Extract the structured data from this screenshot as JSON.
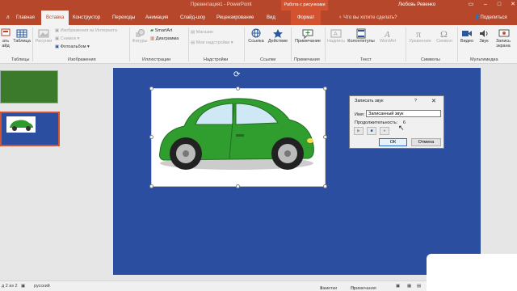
{
  "titlebar": {
    "title": "Презентация1 - PowerPoint",
    "context_title": "Работа с рисунками",
    "user": "Любовь Ревенко",
    "accent": "#b7472a"
  },
  "tabs": [
    "Главная",
    "Вставка",
    "Конструктор",
    "Переходы",
    "Анимация",
    "Слайд-шоу",
    "Рецензирование",
    "Вид",
    "Формат"
  ],
  "active_tab": "Вставка",
  "search_placeholder": "Что вы хотите сделать?",
  "share": "Поделиться",
  "ribbon": {
    "new_slide_label": "ать",
    "new_slide_label2": "айд",
    "table_label": "Таблица",
    "tables_group": "Таблицы",
    "pictures_label": "Рисунки",
    "online_pictures": "Изображения из Интернета",
    "screenshot": "Снимок",
    "photo_album": "Фотоальбом",
    "images_group": "Изображения",
    "shapes_label": "Фигуры",
    "smartart": "SmartArt",
    "chart": "Диаграмма",
    "illustrations_group": "Иллюстрации",
    "store": "Магазин",
    "my_addins": "Мои надстройки",
    "addins_group": "Надстройки",
    "link": "Ссылка",
    "action": "Действие",
    "links_group": "Ссылки",
    "comment": "Примечание",
    "comments_group": "Примечания",
    "textbox": "Надпись",
    "header_footer": "Колонтитулы",
    "wordart": "WordArt",
    "text_group": "Текст",
    "equation": "Уравнение",
    "symbol": "Символ",
    "symbols_group": "Символы",
    "video": "Видео",
    "audio": "Звук",
    "screen_recording": "Запись экрана",
    "media_group": "Мультимедиа"
  },
  "slides_panel": {
    "slide_num": "2"
  },
  "dialog": {
    "title": "Записать звук",
    "help": "?",
    "close": "✕",
    "name_label": "Имя:",
    "name_value": "Записанный звук",
    "duration_label": "Продолжительность:",
    "duration_value": "6",
    "play": "▶",
    "stop": "■",
    "record": "●",
    "ok": "ОК",
    "cancel": "Отмена"
  },
  "statusbar": {
    "slide_info": "д 2 из 2",
    "language": "русский",
    "notes": "Заметки",
    "comments": "Примечания"
  }
}
